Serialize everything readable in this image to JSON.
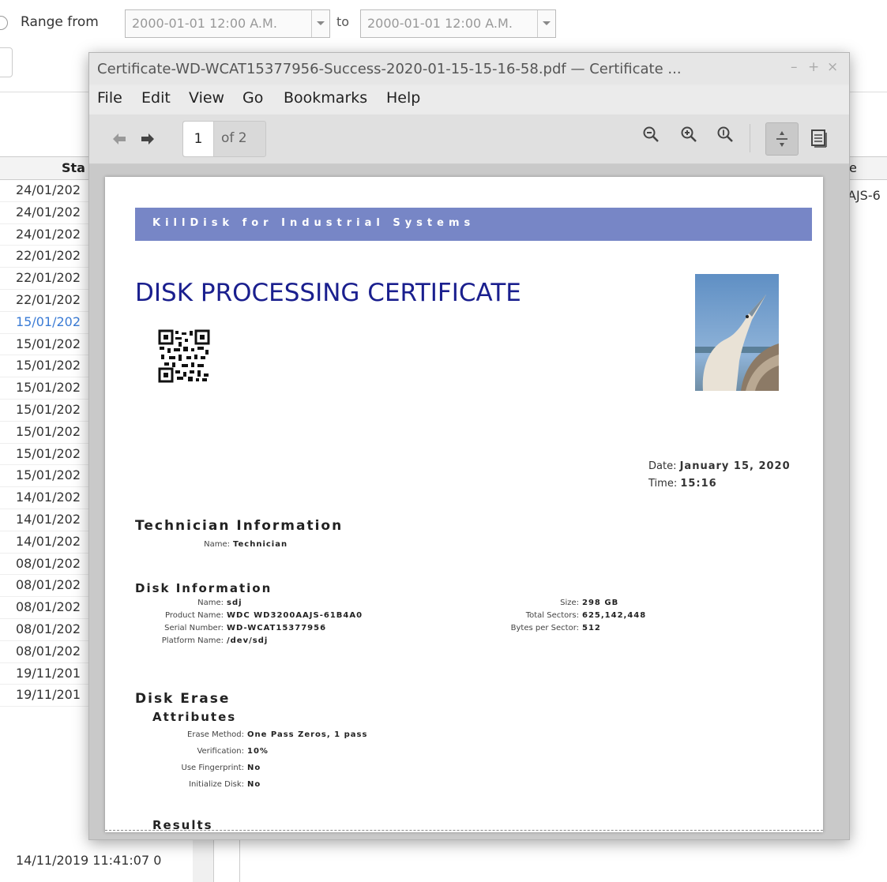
{
  "background": {
    "range_from_label": "Range from",
    "range_from_value": "2000-01-01 12:00 A.M.",
    "to_label": "to",
    "range_to_value": "2000-01-01 12:00 A.M.",
    "column_header_left": "Sta",
    "column_header_right": "e",
    "right_cell_text": "AJS-6",
    "rows": [
      "24/01/202",
      "24/01/202",
      "24/01/202",
      "22/01/202",
      "22/01/202",
      "22/01/202",
      "15/01/202",
      "15/01/202",
      "15/01/202",
      "15/01/202",
      "15/01/202",
      "15/01/202",
      "15/01/202",
      "15/01/202",
      "14/01/202",
      "14/01/202",
      "14/01/202",
      "08/01/202",
      "08/01/202",
      "08/01/202",
      "08/01/202",
      "08/01/202",
      "19/11/201",
      "19/11/201"
    ],
    "selected_row_index": 6,
    "last_row": "14/11/2019 11:41:07  0"
  },
  "viewer": {
    "title": "Certificate-WD-WCAT15377956-Success-2020-01-15-15-16-58.pdf — Certificate ...",
    "window_buttons": {
      "minimize": "–",
      "maximize": "+",
      "close": "×"
    },
    "menu": [
      "File",
      "Edit",
      "View",
      "Go",
      "Bookmarks",
      "Help"
    ],
    "page_current": "1",
    "page_total": "of 2",
    "icons": {
      "back": "arrow-left-icon",
      "forward": "arrow-right-icon",
      "zoom_out": "zoom-out-icon",
      "zoom_in": "zoom-in-icon",
      "zoom_reset": "zoom-original-icon",
      "continuous": "continuous-scroll-icon",
      "dual": "dual-page-icon"
    }
  },
  "certificate": {
    "banner": "KillDisk for Industrial Systems",
    "title": "DISK PROCESSING CERTIFICATE",
    "date_label": "Date:",
    "date_value": "January 15, 2020",
    "time_label": "Time:",
    "time_value": "15:16",
    "technician_heading": "Technician Information",
    "technician": {
      "name_label": "Name:",
      "name_value": "Technician"
    },
    "disk_info_heading": "Disk Information",
    "disk_left": [
      {
        "label": "Name:",
        "value": "sdj"
      },
      {
        "label": "Product Name:",
        "value": "WDC WD3200AAJS-61B4A0"
      },
      {
        "label": "Serial Number:",
        "value": "WD-WCAT15377956"
      },
      {
        "label": "Platform Name:",
        "value": "/dev/sdj"
      }
    ],
    "disk_right": [
      {
        "label": "Size:",
        "value": "298 GB"
      },
      {
        "label": "Total Sectors:",
        "value": "625,142,448"
      },
      {
        "label": "Bytes per Sector:",
        "value": "512"
      }
    ],
    "erase_heading": "Disk Erase",
    "attributes_heading": "Attributes",
    "attributes": [
      {
        "label": "Erase Method:",
        "value": "One Pass Zeros, 1 pass"
      },
      {
        "label": "Verification:",
        "value": "10%"
      },
      {
        "label": "Use Fingerprint:",
        "value": "No"
      },
      {
        "label": "Initialize Disk:",
        "value": "No"
      }
    ],
    "results_heading": "Results"
  },
  "colors": {
    "banner": "#7786c6",
    "title": "#1a1f8e",
    "selected_row": "#3a7bd5"
  }
}
